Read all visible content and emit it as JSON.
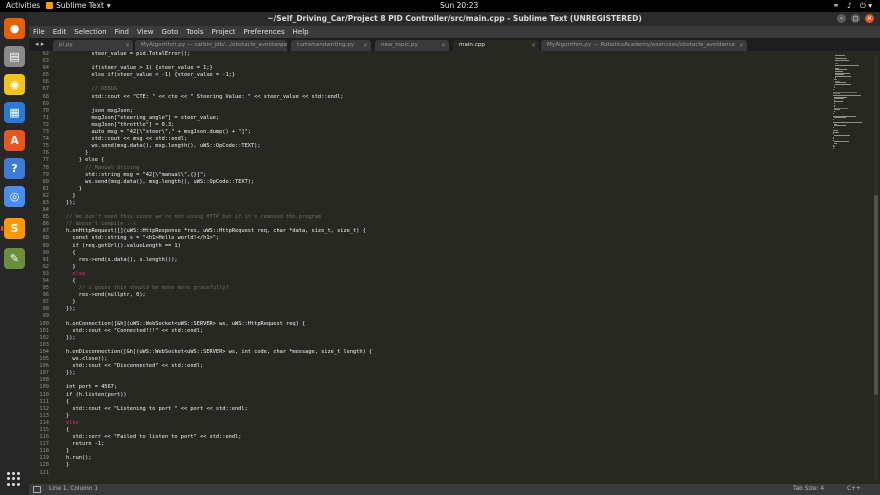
{
  "topbar": {
    "activities": "Activities",
    "app_name": "Sublime Text",
    "app_arrow": "▾",
    "clock": "Sun 20:23",
    "tray_network": "⚭",
    "tray_sound": "♪",
    "tray_power": "⏻ ▾"
  },
  "dock": {
    "items": [
      {
        "name": "firefox-icon",
        "glyph": "●",
        "bg": "#e66000"
      },
      {
        "name": "files-icon",
        "glyph": "▤",
        "bg": "#8a8a8a"
      },
      {
        "name": "rhythmbox-icon",
        "glyph": "◉",
        "bg": "#f0c419"
      },
      {
        "name": "writer-icon",
        "glyph": "▦",
        "bg": "#2a7bd4"
      },
      {
        "name": "software-center-icon",
        "glyph": "A",
        "bg": "#e95420"
      },
      {
        "name": "help-icon",
        "glyph": "?",
        "bg": "#3d7bd8"
      },
      {
        "name": "chromium-icon",
        "glyph": "◎",
        "bg": "#4a8df0"
      },
      {
        "name": "sublime-text-icon",
        "glyph": "S",
        "bg": "#ff9800"
      },
      {
        "name": "editor-icon",
        "glyph": "✎",
        "bg": "#6a8f3a"
      }
    ],
    "apps_grid": "show-applications"
  },
  "window": {
    "title": "~/Self_Driving_Car/Project 8 PID Controller/src/main.cpp - Sublime Text (UNREGISTERED)",
    "btn_min": "–",
    "btn_max": "□",
    "btn_close": "×"
  },
  "menu": [
    "File",
    "Edit",
    "Selection",
    "Find",
    "View",
    "Goto",
    "Tools",
    "Project",
    "Preferences",
    "Help"
  ],
  "tabs": {
    "nav": "◂ ▸",
    "items": [
      {
        "label": "pi.py",
        "active": false
      },
      {
        "label": "MyAlgorithm.py — carbin_jdk/.../obstacle_avoidance",
        "active": false
      },
      {
        "label": "turtlehandwriting.py",
        "active": false
      },
      {
        "label": "new_topic.py",
        "active": false
      },
      {
        "label": "main.cpp",
        "active": true
      },
      {
        "label": "MyAlgorithm.py — RoboticsAcademy/exercises/obstacle_avoidance",
        "active": false
      }
    ]
  },
  "code": [
    {
      "n": "62",
      "t": "        steer_value = pid.TotalError();",
      "k": ""
    },
    {
      "n": "63",
      "t": "",
      "k": ""
    },
    {
      "n": "64",
      "t": "        if(steer_value > 1) {steer_value = 1;}",
      "k": ""
    },
    {
      "n": "65",
      "t": "        else if(steer_value < -1) {steer_value = -1;}",
      "k": ""
    },
    {
      "n": "66",
      "t": "",
      "k": ""
    },
    {
      "n": "67",
      "t": "        // DEBUG",
      "k": "comment"
    },
    {
      "n": "68",
      "t": "        std::cout << \"CTE: \" << cte << \" Steering Value: \" << steer_value << std::endl;",
      "k": ""
    },
    {
      "n": "69",
      "t": "",
      "k": ""
    },
    {
      "n": "70",
      "t": "        json msgJson;",
      "k": ""
    },
    {
      "n": "71",
      "t": "        msgJson[\"steering_angle\"] = steer_value;",
      "k": ""
    },
    {
      "n": "72",
      "t": "        msgJson[\"throttle\"] = 0.3;",
      "k": ""
    },
    {
      "n": "73",
      "t": "        auto msg = \"42[\\\"steer\\\",\" + msgJson.dump() + \"]\";",
      "k": ""
    },
    {
      "n": "74",
      "t": "        std::cout << msg << std::endl;",
      "k": ""
    },
    {
      "n": "75",
      "t": "        ws.send(msg.data(), msg.length(), uWS::OpCode::TEXT);",
      "k": ""
    },
    {
      "n": "76",
      "t": "      }",
      "k": ""
    },
    {
      "n": "77",
      "t": "    } else {",
      "k": ""
    },
    {
      "n": "78",
      "t": "      // Manual driving",
      "k": "comment"
    },
    {
      "n": "79",
      "t": "      std::string msg = \"42[\\\"manual\\\",{}]\";",
      "k": ""
    },
    {
      "n": "80",
      "t": "      ws.send(msg.data(), msg.length(), uWS::OpCode::TEXT);",
      "k": ""
    },
    {
      "n": "81",
      "t": "    }",
      "k": ""
    },
    {
      "n": "82",
      "t": "  }",
      "k": ""
    },
    {
      "n": "83",
      "t": "});",
      "k": ""
    },
    {
      "n": "84",
      "t": "",
      "k": ""
    },
    {
      "n": "85",
      "t": "// We don't need this since we're not using HTTP but if it's removed the program",
      "k": "comment"
    },
    {
      "n": "86",
      "t": "// doesn't compile :-(",
      "k": "comment"
    },
    {
      "n": "87",
      "t": "h.onHttpRequest([](uWS::HttpResponse *res, uWS::HttpRequest req, char *data, size_t, size_t) {",
      "k": ""
    },
    {
      "n": "88",
      "t": "  const std::string s = \"<h1>Hello world!</h1>\";",
      "k": ""
    },
    {
      "n": "89",
      "t": "  if (req.getUrl().valueLength == 1)",
      "k": ""
    },
    {
      "n": "90",
      "t": "  {",
      "k": ""
    },
    {
      "n": "91",
      "t": "    res->end(s.data(), s.length());",
      "k": ""
    },
    {
      "n": "92",
      "t": "  }",
      "k": ""
    },
    {
      "n": "93",
      "t": "  else",
      "k": "kw"
    },
    {
      "n": "94",
      "t": "  {",
      "k": ""
    },
    {
      "n": "95",
      "t": "    // i guess this should be done more gracefully?",
      "k": "comment"
    },
    {
      "n": "96",
      "t": "    res->end(nullptr, 0);",
      "k": ""
    },
    {
      "n": "97",
      "t": "  }",
      "k": ""
    },
    {
      "n": "98",
      "t": "});",
      "k": ""
    },
    {
      "n": "99",
      "t": "",
      "k": ""
    },
    {
      "n": "100",
      "t": "h.onConnection([&h](uWS::WebSocket<uWS::SERVER> ws, uWS::HttpRequest req) {",
      "k": ""
    },
    {
      "n": "101",
      "t": "  std::cout << \"Connected!!!\" << std::endl;",
      "k": ""
    },
    {
      "n": "102",
      "t": "});",
      "k": ""
    },
    {
      "n": "103",
      "t": "",
      "k": ""
    },
    {
      "n": "104",
      "t": "h.onDisconnection([&h](uWS::WebSocket<uWS::SERVER> ws, int code, char *message, size_t length) {",
      "k": ""
    },
    {
      "n": "105",
      "t": "  ws.close();",
      "k": ""
    },
    {
      "n": "106",
      "t": "  std::cout << \"Disconnected\" << std::endl;",
      "k": ""
    },
    {
      "n": "107",
      "t": "});",
      "k": ""
    },
    {
      "n": "108",
      "t": "",
      "k": ""
    },
    {
      "n": "109",
      "t": "int port = 4567;",
      "k": ""
    },
    {
      "n": "110",
      "t": "if (h.listen(port))",
      "k": ""
    },
    {
      "n": "111",
      "t": "{",
      "k": ""
    },
    {
      "n": "112",
      "t": "  std::cout << \"Listening to port \" << port << std::endl;",
      "k": ""
    },
    {
      "n": "113",
      "t": "}",
      "k": ""
    },
    {
      "n": "114",
      "t": "else",
      "k": "kw"
    },
    {
      "n": "115",
      "t": "{",
      "k": ""
    },
    {
      "n": "116",
      "t": "  std::cerr << \"Failed to listen to port\" << std::endl;",
      "k": ""
    },
    {
      "n": "117",
      "t": "  return -1;",
      "k": ""
    },
    {
      "n": "118",
      "t": "}",
      "k": ""
    },
    {
      "n": "119",
      "t": "h.run();",
      "k": ""
    },
    {
      "n": "120",
      "t": "}",
      "k": ""
    },
    {
      "n": "121",
      "t": "",
      "k": ""
    }
  ],
  "status": {
    "position": "Line 1, Column 1",
    "tab_size": "Tab Size: 4",
    "syntax": "C++"
  },
  "colors": {
    "editor_bg": "#272822",
    "keyword": "#f92672",
    "comment": "#75715e",
    "accent": "#e95420"
  }
}
